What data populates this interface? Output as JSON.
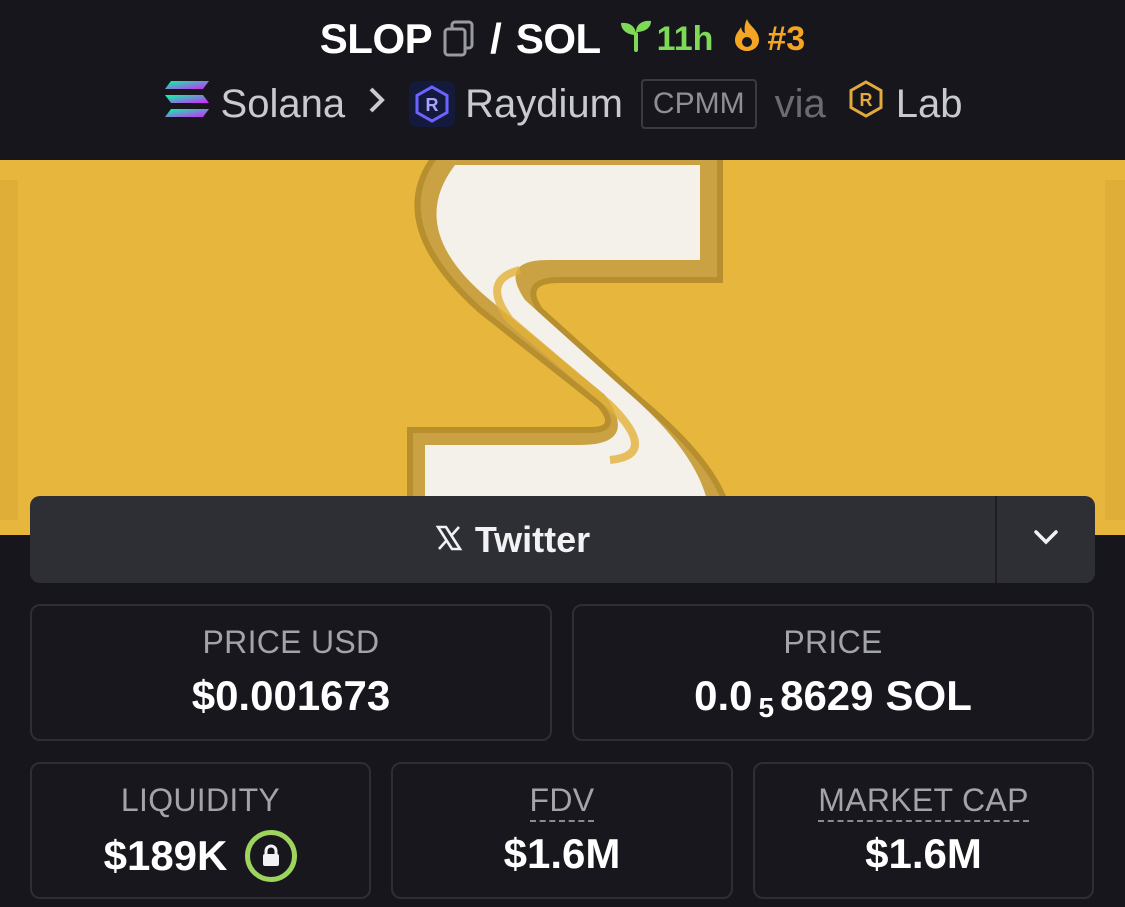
{
  "header": {
    "base_symbol": "SLOP",
    "separator": "/",
    "quote_symbol": "SOL",
    "age": "11h",
    "rank": "#3",
    "chain": "Solana",
    "dex": "Raydium",
    "pool_type": "CPMM",
    "via": "via",
    "launchpad": "Lab",
    "icons": [
      "copy-icon",
      "sprout-icon",
      "flame-icon",
      "solana-logo",
      "raydium-logo",
      "raydium-lab-logo",
      "chevron-right-icon"
    ]
  },
  "banner": {
    "letter": "S",
    "background_color": "#e6b73c"
  },
  "twitter": {
    "label": "Twitter",
    "icons": [
      "x-logo-icon",
      "chevron-down-icon"
    ]
  },
  "stats": {
    "price_usd": {
      "label": "PRICE USD",
      "value": "$0.001673"
    },
    "price": {
      "label": "PRICE",
      "prefix": "0.0",
      "zero_count": "5",
      "digits": "8629",
      "unit": "SOL"
    },
    "liquidity": {
      "label": "LIQUIDITY",
      "value": "$189K",
      "icon": "lock-icon"
    },
    "fdv": {
      "label": "FDV",
      "value": "$1.6M"
    },
    "market_cap": {
      "label": "MARKET CAP",
      "value": "$1.6M"
    }
  },
  "colors": {
    "background": "#16161c",
    "age_green": "#7ed957",
    "rank_orange": "#f5a524",
    "lock_green": "#9ed35e",
    "card_border": "#2e2e35"
  }
}
